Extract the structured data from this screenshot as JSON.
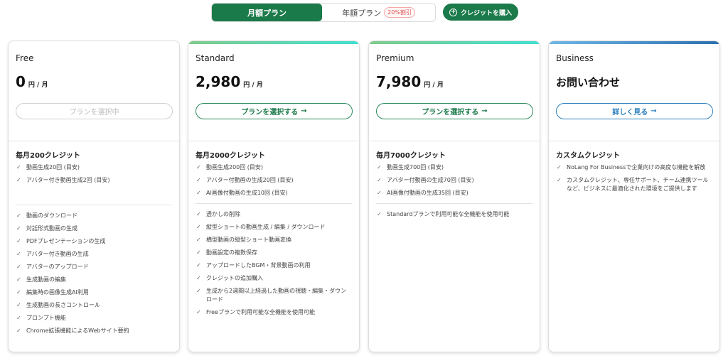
{
  "toggle": {
    "monthly_label": "月額プラン",
    "yearly_label": "年額プラン",
    "discount_badge": "20%割引"
  },
  "credit_button": {
    "label": "クレジットを購入",
    "icon": "plus-circle-icon"
  },
  "colors": {
    "primary_green": "#1b7a4a",
    "business_blue": "#2b7fbf",
    "accent_teal": "#3fe0d0"
  },
  "plans": [
    {
      "name": "Free",
      "price": "0",
      "unit": "円 / 月",
      "button": "プランを選択中",
      "credit_title": "毎月200クレジット",
      "credit_items": [
        "動画生成20回 (目安)",
        "アバター付き動画生成2回 (目安)"
      ],
      "features": [
        "動画のダウンロード",
        "対話形式動画の生成",
        "PDFプレゼンテーションの生成",
        "アバター付き動画の生成",
        "アバターのアップロード",
        "生成動画の編集",
        "編集時の画像生成AI利用",
        "生成動画の長さコントロール",
        "プロンプト機能",
        "Chrome拡張機能によるWebサイト要約"
      ]
    },
    {
      "name": "Standard",
      "price": "2,980",
      "unit": "円 / 月",
      "button": "プランを選択する",
      "credit_title": "毎月2000クレジット",
      "credit_items": [
        "動画生成200回 (目安)",
        "アバター付動画の生成20回 (目安)",
        "AI画像付動画の生成10回 (目安)"
      ],
      "features": [
        "透かしの削除",
        "縦型ショートの動画生成 / 編集 / ダウンロード",
        "横型動画の縦型ショート動画変換",
        "動画設定の複数保存",
        "アップロードしたBGM・背景動画の利用",
        "クレジットの追加購入",
        "生成から2週間以上経過した動画の視聴・編集・ダウンロード",
        "Freeプランで利用可能な全機能を使用可能"
      ]
    },
    {
      "name": "Premium",
      "price": "7,980",
      "unit": "円 / 月",
      "button": "プランを選択する",
      "credit_title": "毎月7000クレジット",
      "credit_items": [
        "動画生成700回 (目安)",
        "アバター付動画の生成70回 (目安)",
        "AI画像付動画の生成35回 (目安)"
      ],
      "features": [
        "Standardプランで利用可能な全機能を使用可能"
      ]
    },
    {
      "name": "Business",
      "price_text": "お問い合わせ",
      "button": "詳しく見る",
      "credit_title": "カスタムクレジット",
      "credit_items": [
        "NoLang For Businessで企業向けの高度な機能を解放",
        "カスタムクレジット、専任サポート、チーム連携ツールなど、ビジネスに最適化された環境をご提供します"
      ]
    }
  ],
  "arrow_glyph": "→",
  "check_glyph": "✓"
}
